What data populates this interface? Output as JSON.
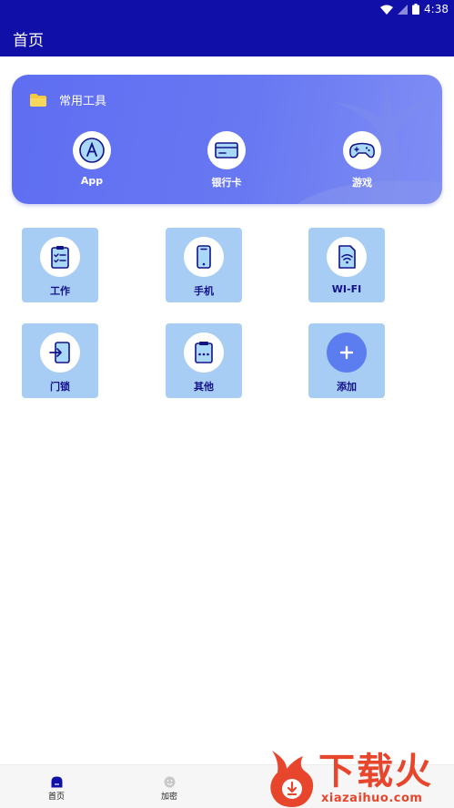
{
  "status_bar": {
    "time": "4:38"
  },
  "app_bar": {
    "title": "首页"
  },
  "tools_card": {
    "title": "常用工具",
    "items": [
      {
        "label": "App",
        "icon": "app-store-icon"
      },
      {
        "label": "银行卡",
        "icon": "bank-card-icon"
      },
      {
        "label": "游戏",
        "icon": "gamepad-icon"
      }
    ]
  },
  "grid": {
    "items": [
      {
        "label": "工作",
        "icon": "clipboard-icon"
      },
      {
        "label": "手机",
        "icon": "phone-icon"
      },
      {
        "label": "WI-FI",
        "icon": "wifi-card-icon"
      },
      {
        "label": "门锁",
        "icon": "login-door-icon"
      },
      {
        "label": "其他",
        "icon": "dots-card-icon"
      },
      {
        "label": "添加",
        "icon": "plus-icon"
      }
    ]
  },
  "bottom_nav": {
    "items": [
      {
        "label": "首页",
        "icon": "home-icon",
        "active": true
      },
      {
        "label": "加密",
        "icon": "smiley-icon",
        "active": false
      }
    ]
  },
  "watermark": {
    "brand": "下载火",
    "url": "xiazaihuo.com"
  },
  "colors": {
    "primary": "#1010a8",
    "card_gradient": "#6878f2",
    "tile_background": "#a7cdf5",
    "tile_text": "#12128a",
    "add_button": "#5b7df0",
    "watermark": "#e8452d"
  }
}
